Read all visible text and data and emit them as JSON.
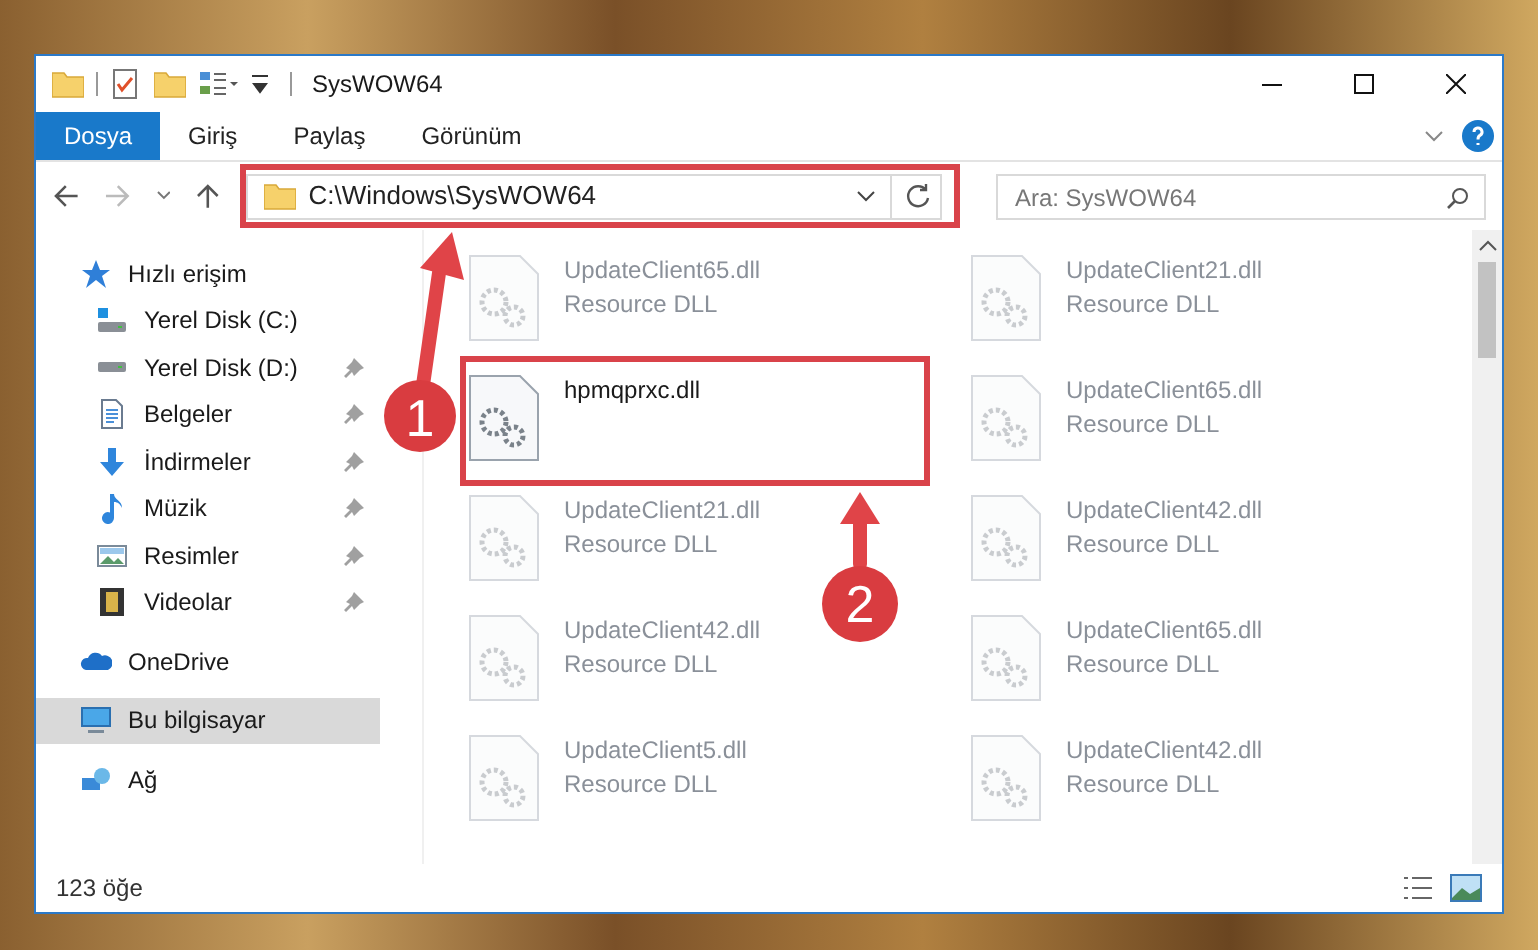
{
  "window": {
    "title": "SysWOW64"
  },
  "ribbon_tabs": [
    {
      "label": "Dosya",
      "selected": true
    },
    {
      "label": "Giriş",
      "selected": false
    },
    {
      "label": "Paylaş",
      "selected": false
    },
    {
      "label": "Görünüm",
      "selected": false
    }
  ],
  "address": {
    "value": "C:\\Windows\\SysWOW64"
  },
  "search": {
    "placeholder": "Ara: SysWOW64"
  },
  "sidebar": {
    "items": [
      {
        "label": "Hızlı erişim",
        "kind": "star",
        "selected": false,
        "children": [
          {
            "label": "Yerel Disk (C:)",
            "kind": "drive-c",
            "pinned": false,
            "selected": false
          },
          {
            "label": "Yerel Disk (D:)",
            "kind": "drive",
            "pinned": true,
            "selected": false
          },
          {
            "label": "Belgeler",
            "kind": "docs",
            "pinned": true,
            "selected": false
          },
          {
            "label": "İndirmeler",
            "kind": "download",
            "pinned": true,
            "selected": false
          },
          {
            "label": "Müzik",
            "kind": "music",
            "pinned": true,
            "selected": false
          },
          {
            "label": "Resimler",
            "kind": "pictures",
            "pinned": true,
            "selected": false
          },
          {
            "label": "Videolar",
            "kind": "video",
            "pinned": true,
            "selected": false
          }
        ]
      },
      {
        "label": "OneDrive",
        "kind": "cloud",
        "selected": false
      },
      {
        "label": "Bu bilgisayar",
        "kind": "pc",
        "selected": true
      },
      {
        "label": "Ağ",
        "kind": "network",
        "selected": false
      }
    ]
  },
  "files": [
    {
      "name": "UpdateClient65.dll",
      "type": "Resource DLL",
      "faded": true
    },
    {
      "name": "UpdateClient21.dll",
      "type": "Resource DLL",
      "faded": true
    },
    {
      "name": "hpmqprxc.dll",
      "faded": false
    },
    {
      "name": "UpdateClient65.dll",
      "type": "Resource DLL",
      "faded": true
    },
    {
      "name": "UpdateClient21.dll",
      "type": "Resource DLL",
      "faded": true
    },
    {
      "name": "UpdateClient42.dll",
      "type": "Resource DLL",
      "faded": true
    },
    {
      "name": "UpdateClient42.dll",
      "type": "Resource DLL",
      "faded": true
    },
    {
      "name": "UpdateClient65.dll",
      "type": "Resource DLL",
      "faded": true
    },
    {
      "name": "UpdateClient5.dll",
      "type": "Resource DLL",
      "faded": true
    },
    {
      "name": "UpdateClient42.dll",
      "type": "Resource DLL",
      "faded": true
    }
  ],
  "status_bar": {
    "count": "123 öğe"
  },
  "annotations": [
    {
      "number": "1"
    },
    {
      "number": "2"
    }
  ]
}
